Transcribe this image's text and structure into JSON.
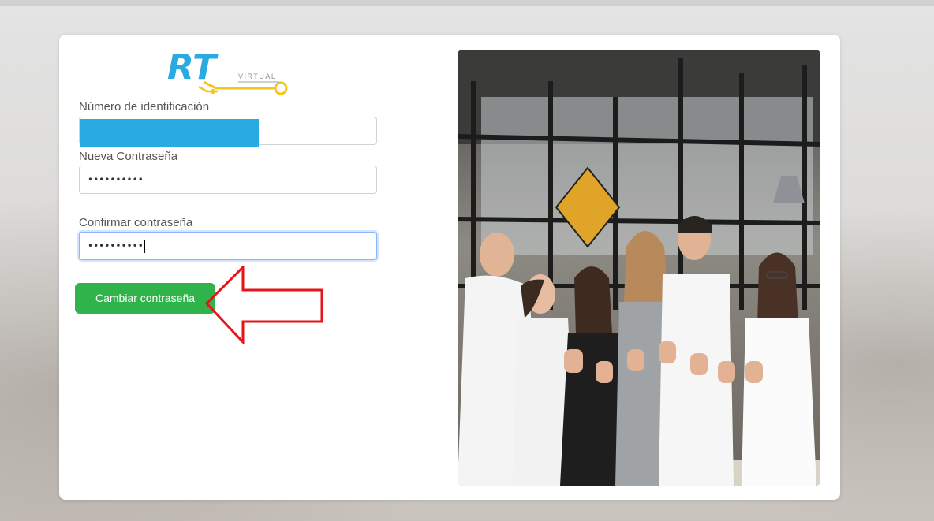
{
  "logo": {
    "letters": "RT",
    "subtitle": "VIRTUAL"
  },
  "form": {
    "id_label": "Número de identificación",
    "id_value": "",
    "new_password_label": "Nueva Contraseña",
    "new_password_value": "••••••••••",
    "confirm_password_label": "Confirmar contraseña",
    "confirm_password_value": "••••••••••",
    "submit_label": "Cambiar contraseña"
  },
  "colors": {
    "logo_blue": "#29abe2",
    "logo_yellow": "#f5c518",
    "button_green": "#2fb34a",
    "annotation_red": "#e5141b",
    "redaction": "#29abe2"
  }
}
